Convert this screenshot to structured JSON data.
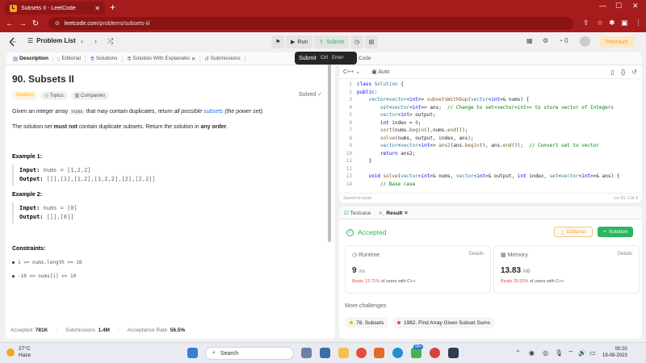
{
  "browser": {
    "tab_title": "Subsets II - LeetCode",
    "url_host": "leetcode.com",
    "url_path": "/problems/subsets-ii/"
  },
  "header": {
    "problem_list": "Problem List",
    "run": "Run",
    "submit": "Submit",
    "notif_count": "0",
    "premium": "Premium"
  },
  "tooltip": {
    "label": "Submit",
    "key1": "Ctrl",
    "key2": "Enter"
  },
  "left_tabs": [
    {
      "label": "Description"
    },
    {
      "label": "Editorial"
    },
    {
      "label": "Solutions"
    },
    {
      "label": "Solution With Explanatio"
    },
    {
      "label": "Submissions"
    }
  ],
  "problem": {
    "title": "90. Subsets II",
    "solved": "Solved",
    "difficulty": "Medium",
    "topics": "Topics",
    "companies": "Companies",
    "desc1_a": "Given an integer array ",
    "desc1_code": "nums",
    "desc1_b": " that may contain duplicates, return ",
    "desc1_i": "all possible ",
    "desc1_link": "subsets",
    "desc1_c": " (the power set).",
    "desc2_a": "The solution set ",
    "desc2_b": "must not",
    "desc2_c": " contain duplicate subsets. Return the solution in ",
    "desc2_d": "any order",
    "desc2_e": ".",
    "example1_title": "Example 1:",
    "example1_input": "nums = [1,2,2]",
    "example1_output": "[[],[1],[1,2],[1,2,2],[2],[2,2]]",
    "example2_title": "Example 2:",
    "example2_input": "nums = [0]",
    "example2_output": "[[],[0]]",
    "input_label": "Input:",
    "output_label": "Output:",
    "constraints_title": "Constraints:",
    "constraint1": "1 <= nums.length <= 10",
    "constraint2": "-10 <= nums[i] <= 10",
    "accepted_label": "Accepted",
    "accepted_value": "781K",
    "submissions_label": "Submissions",
    "submissions_value": "1.4M",
    "rate_label": "Acceptance Rate",
    "rate_value": "56.5%",
    "likes": "9K",
    "dislikes": "253"
  },
  "code": {
    "tab_label": "Code",
    "language": "C++",
    "mode": "Auto",
    "saved": "Saved to local",
    "cursor": "Ln 10, Col 3",
    "lines": [
      "1",
      "2",
      "3",
      "4",
      "5",
      "6",
      "7",
      "8",
      "9",
      "10",
      "11",
      "12",
      "13",
      "14"
    ]
  },
  "result": {
    "tab_testcase": "Testcase",
    "tab_result": "Result",
    "status": "Accepted",
    "editorial": "Editorial",
    "solution": "Solution",
    "runtime_label": "Runtime",
    "runtime_value": "9",
    "runtime_unit": "ms",
    "runtime_beats": "Beats 13.71%",
    "runtime_suffix": "of users with C++",
    "memory_label": "Memory",
    "memory_value": "13.83",
    "memory_unit": "MB",
    "memory_beats": "Beats 25.52%",
    "memory_suffix": "of users with C++",
    "details": "Details",
    "more": "More challenges",
    "challenge1": "78. Subsets",
    "challenge2": "1982. Find Array Given Subset Sums"
  },
  "taskbar": {
    "temp": "27°C",
    "weather": "Haze",
    "search": "Search",
    "badge": "99+",
    "time": "00:20",
    "date": "19-09-2023"
  },
  "colors": {
    "accent": "#ffa116",
    "success": "#2db55d",
    "chrome": "#a61b1b"
  }
}
